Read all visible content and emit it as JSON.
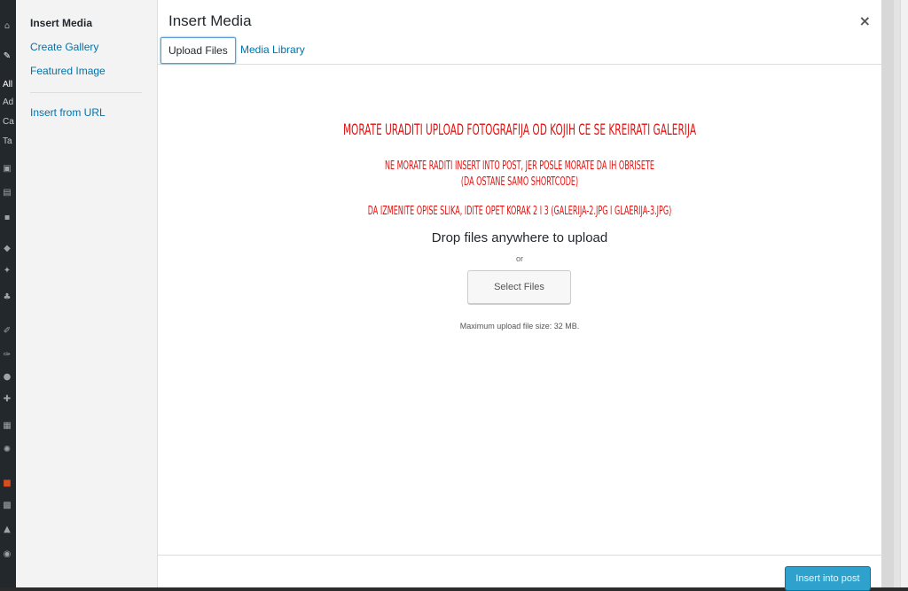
{
  "admin_sidebar": {
    "labels": [
      "All",
      "Ad",
      "Ca",
      "Ta"
    ]
  },
  "media_menu": {
    "items": [
      {
        "label": "Insert Media",
        "active": true
      },
      {
        "label": "Create Gallery",
        "active": false
      },
      {
        "label": "Featured Image",
        "active": false
      },
      {
        "label": "Insert from URL",
        "active": false
      }
    ]
  },
  "modal": {
    "title": "Insert Media",
    "close_icon": "×",
    "tabs": [
      {
        "label": "Upload Files",
        "active": true
      },
      {
        "label": "Media Library",
        "active": false
      }
    ]
  },
  "notice": {
    "line1": "MORATE URADITI UPLOAD FOTOGRAFIJA OD KOJIH CE SE KREIRATI GALERIJA",
    "line2": "NE MORATE RADITI INSERT INTO POST, JER POSLE MORATE DA IH OBRISETE",
    "line3": "(DA OSTANE SAMO SHORTCODE)",
    "line4": "DA IZMENITE OPISE SLIKA, IDITE OPET KORAK 2 I 3 (GALERIJA-2.JPG I GLAERIJA-3.JPG)",
    "color": "#e3110e"
  },
  "uploader": {
    "drop_text": "Drop files anywhere to upload",
    "or_text": "or",
    "select_button": "Select Files",
    "max_size": "Maximum upload file size: 32 MB."
  },
  "toolbar": {
    "insert_button": "Insert into post",
    "accent": "#2ea2cc"
  }
}
